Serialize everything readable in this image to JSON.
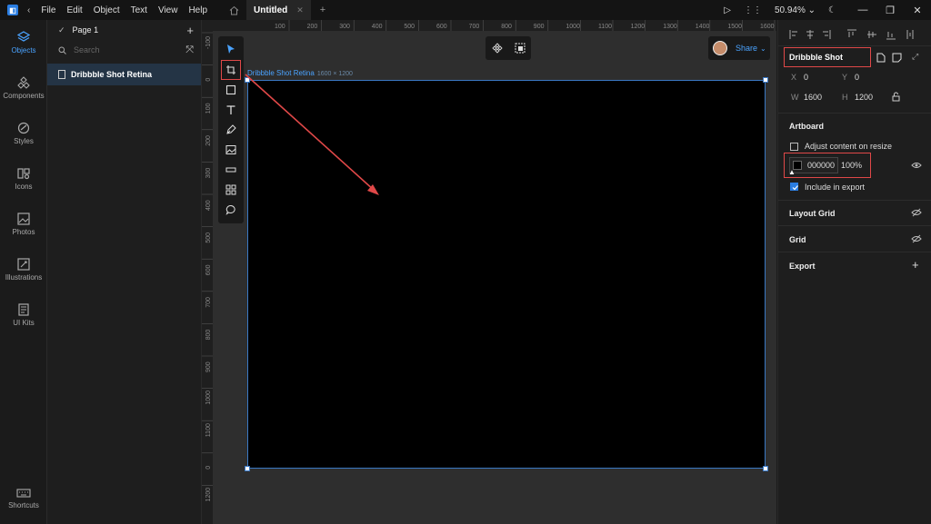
{
  "menu": [
    "File",
    "Edit",
    "Object",
    "Text",
    "View",
    "Help"
  ],
  "document": {
    "tab_title": "Untitled"
  },
  "topbar": {
    "zoom": "50.94%"
  },
  "rail": [
    {
      "label": "Objects",
      "icon": "layers-icon",
      "active": true
    },
    {
      "label": "Components",
      "icon": "components-icon"
    },
    {
      "label": "Styles",
      "icon": "styles-icon"
    },
    {
      "label": "Icons",
      "icon": "icons-icon"
    },
    {
      "label": "Photos",
      "icon": "photos-icon"
    },
    {
      "label": "Illustrations",
      "icon": "illustrations-icon"
    },
    {
      "label": "UI Kits",
      "icon": "uikits-icon"
    },
    {
      "label": "Shortcuts",
      "icon": "keyboard-icon"
    }
  ],
  "layers": {
    "page": "Page 1",
    "search_placeholder": "Search",
    "items": [
      "Dribbble Shot Retina"
    ]
  },
  "rulers": {
    "h": [
      "100",
      "200",
      "300",
      "400",
      "500",
      "600",
      "700",
      "800",
      "900",
      "1000",
      "1100",
      "1200",
      "1300",
      "1400",
      "1500",
      "1600"
    ],
    "v": [
      "-100",
      "0",
      "100",
      "200",
      "300",
      "400",
      "500",
      "600",
      "700",
      "800",
      "900",
      "1000",
      "1100",
      "0",
      "1200"
    ]
  },
  "canvas": {
    "share_label": "Share",
    "artboard_name": "Dribbble Shot Retina",
    "artboard_dims": "1600 × 1200",
    "artboard_fill": "#000000"
  },
  "props": {
    "name": "Dribbble Shot",
    "x_label": "X",
    "x": "0",
    "y_label": "Y",
    "y": "0",
    "w_label": "W",
    "w": "1600",
    "h_label": "H",
    "h": "1200",
    "artboard_title": "Artboard",
    "adjust_label": "Adjust content on resize",
    "fill_hex": "000000",
    "fill_opacity": "100%",
    "include_label": "Include in export",
    "layout_grid": "Layout Grid",
    "grid": "Grid",
    "export": "Export"
  },
  "colors": {
    "accent": "#2a7de1",
    "highlight": "#e04848",
    "arrow": "#e04848"
  }
}
